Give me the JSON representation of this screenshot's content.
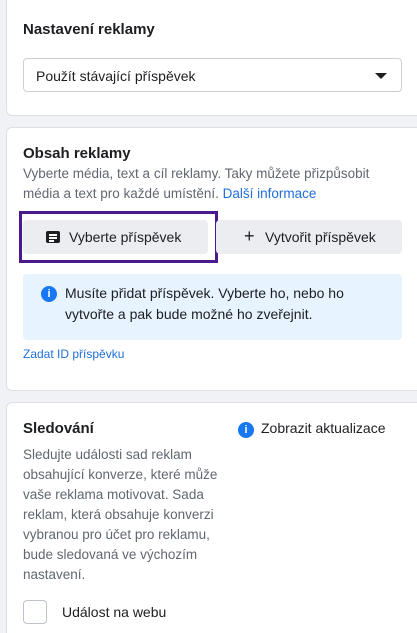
{
  "ad_settings": {
    "heading": "Nastavení reklamy",
    "select_value": "Použít stávající příspěvek"
  },
  "ad_content": {
    "heading": "Obsah reklamy",
    "description": "Vyberte média, text a cíl reklamy. Taky můžete přizpůsobit média a text pro každé umístění.",
    "more_info_link": "Další informace",
    "select_post_button": "Vyberte příspěvek",
    "create_post_button": "Vytvořit příspěvek",
    "info_message": "Musíte přidat příspěvek. Vyberte ho, nebo ho vytvořte a pak bude možné ho zveřejnit.",
    "enter_id_link": "Zadat ID příspěvku"
  },
  "tracking": {
    "heading": "Sledování",
    "description": "Sledujte události sad reklam obsahující konverze, které může vaše reklama motivovat. Sada reklam, která obsahuje konverzi vybranou pro účet pro reklamu, bude sledovaná ve výchozím nastavení.",
    "show_updates_label": "Zobrazit aktualizace",
    "web_event_label": "Událost na webu"
  },
  "colors": {
    "link": "#216fdb",
    "info_background": "#e7f3ff",
    "highlight_border": "#4a1a8c"
  }
}
